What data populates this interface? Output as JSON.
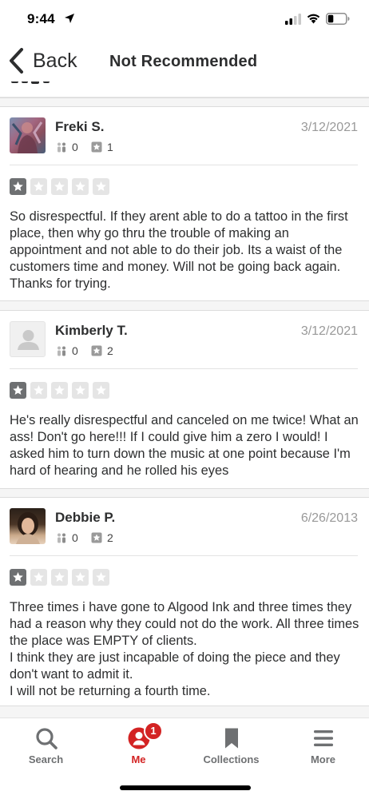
{
  "status_bar": {
    "time": "9:44"
  },
  "nav": {
    "back_label": "Back",
    "title": "Not Recommended"
  },
  "reviews": [
    {
      "name": "Freki S.",
      "date": "3/12/2021",
      "friends": "0",
      "reviews_count": "1",
      "rating": 1,
      "text": "So disrespectful. If they arent able to do a tattoo in the first place, then why go thru the trouble of making an appointment and not able to do their job. Its a waist of the customers time and money. Will not be going back again. Thanks for trying."
    },
    {
      "name": "Kimberly T.",
      "date": "3/12/2021",
      "friends": "0",
      "reviews_count": "2",
      "rating": 1,
      "text": "He's really disrespectful and canceled on me twice! What an ass! Don't go here!!! If I could give him a zero I would! I asked him to turn down the music at one point because I'm hard of hearing and he rolled his eyes"
    },
    {
      "name": "Debbie P.",
      "date": "6/26/2013",
      "friends": "0",
      "reviews_count": "2",
      "rating": 1,
      "text": "Three times i have gone to Algood Ink and three times they had a reason why they could not do the work. All three times the place was EMPTY of clients.\nI think they are just incapable of doing the piece and they don't want to admit it.\nI will not be returning a fourth time."
    }
  ],
  "tabs": [
    {
      "label": "Search",
      "icon": "search-icon"
    },
    {
      "label": "Me",
      "icon": "profile-icon",
      "badge": "1"
    },
    {
      "label": "Collections",
      "icon": "bookmark-icon"
    },
    {
      "label": "More",
      "icon": "menu-icon"
    }
  ],
  "colors": {
    "accent": "#d32323",
    "star_filled": "#6e7072",
    "star_empty": "#e5e5e5"
  }
}
